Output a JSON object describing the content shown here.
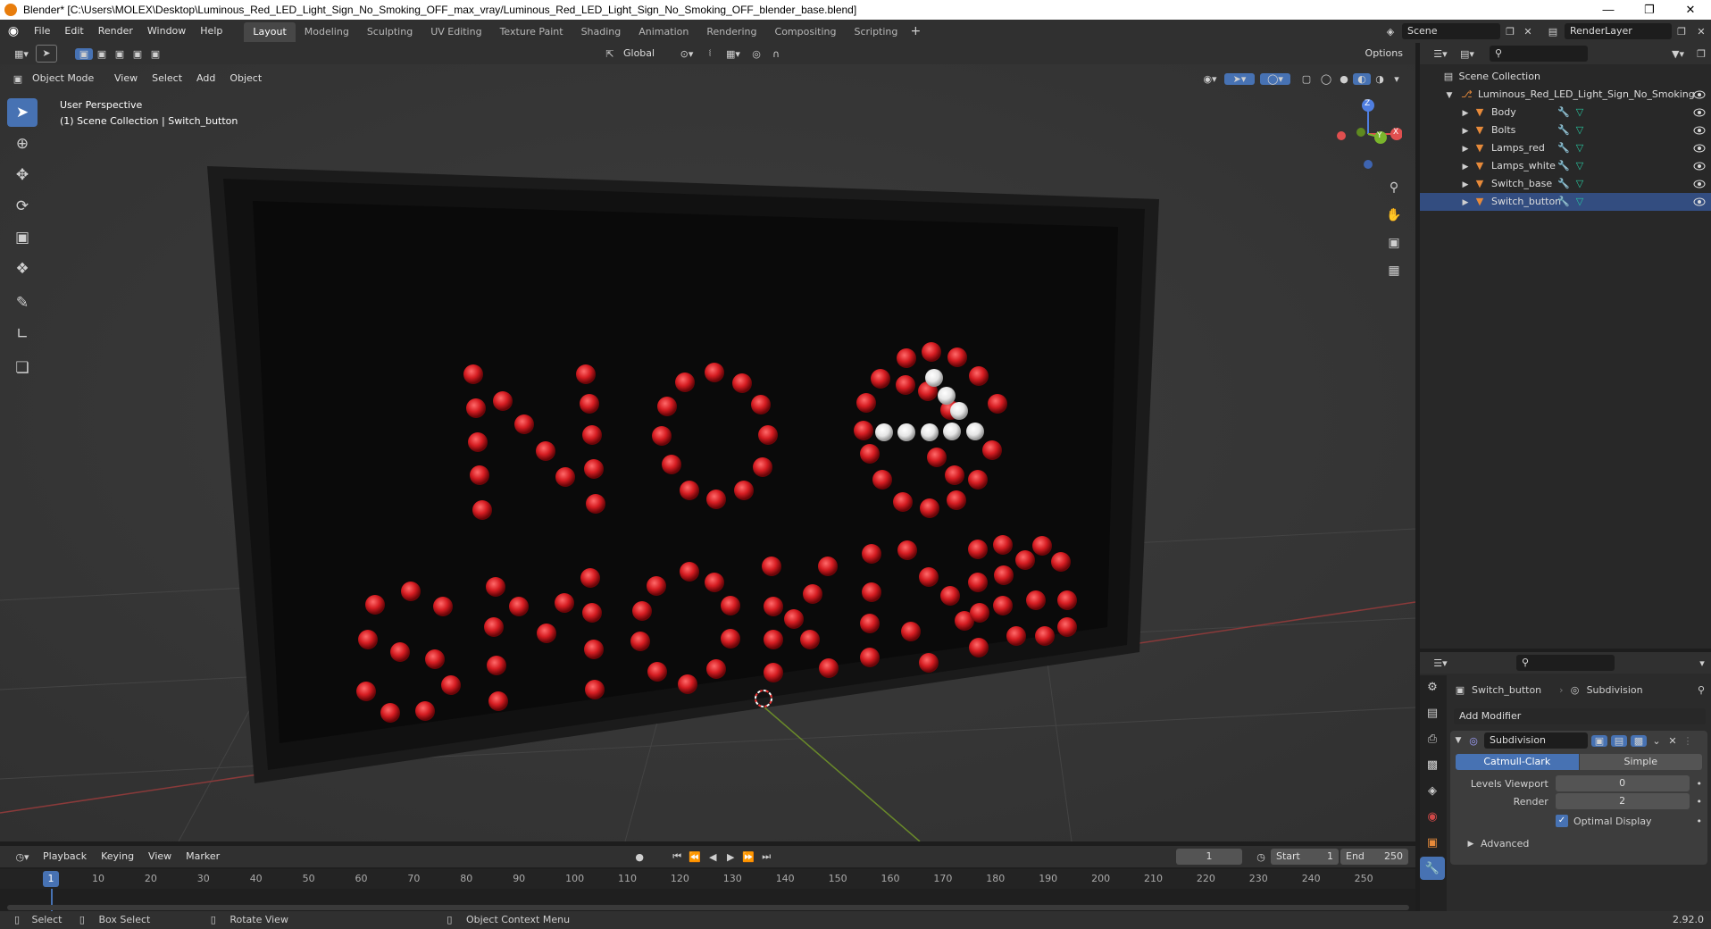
{
  "window": {
    "title": "Blender* [C:\\Users\\MOLEX\\Desktop\\Luminous_Red_LED_Light_Sign_No_Smoking_OFF_max_vray/Luminous_Red_LED_Light_Sign_No_Smoking_OFF_blender_base.blend]"
  },
  "menu": [
    "File",
    "Edit",
    "Render",
    "Window",
    "Help"
  ],
  "workspaces": [
    "Layout",
    "Modeling",
    "Sculpting",
    "UV Editing",
    "Texture Paint",
    "Shading",
    "Animation",
    "Rendering",
    "Compositing",
    "Scripting"
  ],
  "scene": {
    "name": "Scene",
    "render_layer": "RenderLayer"
  },
  "tool_header": {
    "orientation": "Global",
    "options": "Options"
  },
  "viewport_header": {
    "mode": "Object Mode",
    "menus": [
      "View",
      "Select",
      "Add",
      "Object"
    ]
  },
  "viewport": {
    "perspective": "User Perspective",
    "context": "(1) Scene Collection | Switch_button"
  },
  "gizmo": {
    "x": "X",
    "y": "Y",
    "z": "Z"
  },
  "outliner": {
    "root": "Scene Collection",
    "collection": "Luminous_Red_LED_Light_Sign_No_Smoking",
    "items": [
      "Body",
      "Bolts",
      "Lamps_red",
      "Lamps_white",
      "Switch_base",
      "Switch_button"
    ]
  },
  "properties": {
    "object": "Switch_button",
    "modifier_crumb": "Subdivision",
    "add_modifier": "Add Modifier",
    "modifier_name": "Subdivision",
    "tabs": [
      "Catmull-Clark",
      "Simple"
    ],
    "levels_viewport_label": "Levels Viewport",
    "levels_viewport": "0",
    "render_label": "Render",
    "render": "2",
    "optimal_display": "Optimal Display",
    "advanced": "Advanced"
  },
  "timeline": {
    "menus": [
      "Playback",
      "Keying",
      "View",
      "Marker"
    ],
    "current_frame": "1",
    "start_label": "Start",
    "start": "1",
    "end_label": "End",
    "end": "250",
    "ruler": [
      "10",
      "20",
      "30",
      "40",
      "50",
      "60",
      "70",
      "80",
      "90",
      "100",
      "110",
      "120",
      "130",
      "140",
      "150",
      "160",
      "170",
      "180",
      "190",
      "200",
      "210",
      "220",
      "230",
      "240",
      "250"
    ],
    "playhead": "1"
  },
  "status": {
    "select": "Select",
    "box_select": "Box Select",
    "rotate": "Rotate View",
    "context_menu": "Object Context Menu",
    "version": "2.92.0"
  },
  "colors": {
    "accent": "#4772b3",
    "led_red": "#d41f24",
    "led_white": "#f0f0f0",
    "object_orange": "#e78a3a"
  }
}
